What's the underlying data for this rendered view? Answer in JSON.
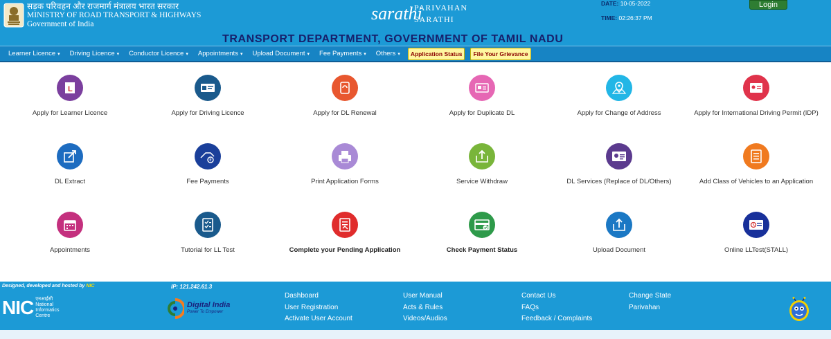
{
  "header": {
    "ministry_hindi": "सड़क परिवहन और राजमार्ग मंत्रालय भारत सरकार",
    "ministry_english": "MINISTRY OF ROAD TRANSPORT & HIGHWAYS",
    "government": "Government of India",
    "sarathi_logo": "sarathi",
    "parivahan": "PARIVAHAN",
    "sarathi": "SARATHI",
    "date_label": "DATE:",
    "date_value": "10-05-2022",
    "time_label": "TIME:",
    "time_value": "02:26:37 PM",
    "login_label": "Login"
  },
  "banner": {
    "title": "TRANSPORT DEPARTMENT, GOVERNMENT OF TAMIL NADU"
  },
  "nav": {
    "items": [
      {
        "label": "Learner Licence"
      },
      {
        "label": "Driving Licence"
      },
      {
        "label": "Conductor Licence"
      },
      {
        "label": "Appointments"
      },
      {
        "label": "Upload Document"
      },
      {
        "label": "Fee Payments"
      },
      {
        "label": "Others"
      }
    ],
    "caret": "▾",
    "application_status": "Application Status",
    "grievance": "File Your Grievance"
  },
  "services": [
    {
      "label": "Apply for Learner Licence",
      "icon": "learner-licence-icon",
      "color": "#7b3f9e"
    },
    {
      "label": "Apply for Driving Licence",
      "icon": "driving-licence-icon",
      "color": "#1a5a8c"
    },
    {
      "label": "Apply for DL Renewal",
      "icon": "dl-renewal-icon",
      "color": "#e8572f"
    },
    {
      "label": "Apply for Duplicate DL",
      "icon": "duplicate-dl-icon",
      "color": "#e667b4"
    },
    {
      "label": "Apply for Change of Address",
      "icon": "change-address-icon",
      "color": "#22b6e6"
    },
    {
      "label": "Apply for International Driving Permit (IDP)",
      "icon": "idp-icon",
      "color": "#e0334b"
    },
    {
      "label": "DL Extract",
      "icon": "dl-extract-icon",
      "color": "#1d6cc0"
    },
    {
      "label": "Fee Payments",
      "icon": "fee-payments-icon",
      "color": "#1a3f9a"
    },
    {
      "label": "Print Application Forms",
      "icon": "print-forms-icon",
      "color": "#a98ad6"
    },
    {
      "label": "Service Withdraw",
      "icon": "service-withdraw-icon",
      "color": "#79b53a"
    },
    {
      "label": "DL Services (Replace of DL/Others)",
      "icon": "dl-services-icon",
      "color": "#5b3a8e"
    },
    {
      "label": "Add Class of Vehicles to an Application",
      "icon": "add-class-icon",
      "color": "#f07a1f"
    },
    {
      "label": "Appointments",
      "icon": "appointments-icon",
      "color": "#c4307e"
    },
    {
      "label": "Tutorial for LL Test",
      "icon": "tutorial-icon",
      "color": "#1a5a8c"
    },
    {
      "label": "Complete your Pending Application",
      "icon": "pending-application-icon",
      "color": "#e02c2c"
    },
    {
      "label": "Check Payment Status",
      "icon": "payment-status-icon",
      "color": "#2e9a4a"
    },
    {
      "label": "Upload Document",
      "icon": "upload-document-icon",
      "color": "#1b78c4"
    },
    {
      "label": "Online LLTest(STALL)",
      "icon": "online-lltest-icon",
      "color": "#18309a"
    }
  ],
  "footer": {
    "designed_by": "Designed, developed and hosted by",
    "nic_link": "NIC",
    "ip": "IP: 121.242.61.3",
    "nic_logo": "NIC",
    "nic_hindi": "एनआईसी",
    "nic_name_1": "National",
    "nic_name_2": "Informatics",
    "nic_name_3": "Centre",
    "digital_india": "Digital India",
    "digital_india_tag": "Power To Empower",
    "columns": [
      [
        "Dashboard",
        "User Registration",
        "Activate User Account"
      ],
      [
        "User Manual",
        "Acts & Rules",
        "Videos/Audios"
      ],
      [
        "Contact Us",
        "FAQs",
        "Feedback / Complaints"
      ],
      [
        "Change State",
        "Parivahan"
      ]
    ]
  }
}
